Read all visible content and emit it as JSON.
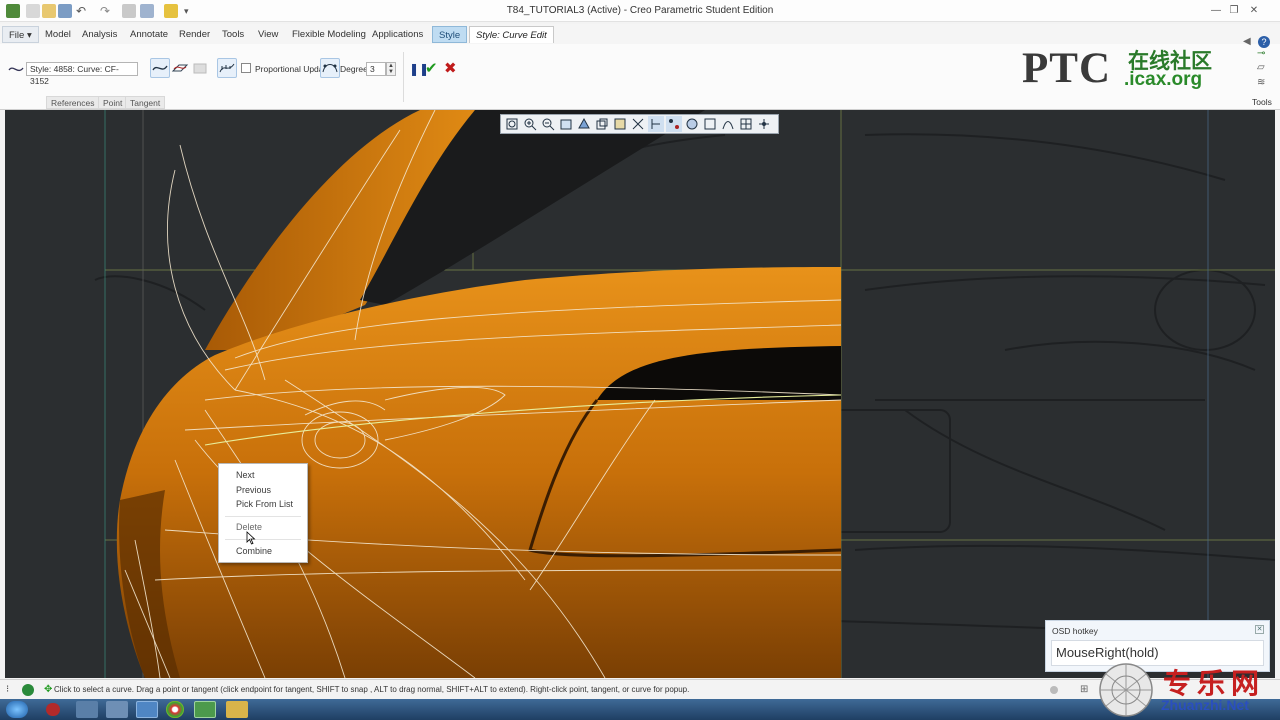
{
  "window": {
    "title": "T84_TUTORIAL3 (Active) - Creo Parametric Student Edition"
  },
  "menu_tabs": [
    {
      "label": "File",
      "suffix": "▾"
    },
    {
      "label": "Model"
    },
    {
      "label": "Analysis"
    },
    {
      "label": "Annotate"
    },
    {
      "label": "Render"
    },
    {
      "label": "Tools"
    },
    {
      "label": "View"
    },
    {
      "label": "Flexible Modeling"
    },
    {
      "label": "Applications"
    },
    {
      "label": "Style"
    },
    {
      "label": "Style: Curve Edit"
    }
  ],
  "ribbon": {
    "curve_selector_value": "Style: 4858: Curve:  CF-3152",
    "proportional_update_label": "Proportional Update",
    "proportional_update_checked": false,
    "degree_label": "Degree",
    "degree_value": "3",
    "subtabs": [
      "References",
      "Point",
      "Tangent"
    ],
    "tools_label": "Tools"
  },
  "logo": {
    "brand": "PTC",
    "chinese": "在线社区",
    "url": ".icax.org"
  },
  "context_menu": {
    "items": [
      "Next",
      "Previous",
      "Pick From List",
      "Delete",
      "Combine"
    ],
    "hovered": "Delete"
  },
  "osd": {
    "title": "OSD hotkey",
    "value": "MouseRight(hold)"
  },
  "status_bar": {
    "message": "Click to select a curve. Drag a point or tangent (click endpoint for tangent, SHIFT to snap , ALT to drag normal, SHIFT+ALT to extend). Right-click point, tangent, or curve for popup."
  },
  "watermark": {
    "chinese": "专乐网",
    "url": "Zhuanzhi.Net"
  },
  "colors": {
    "viewport_bg": "#2b2e30",
    "surface_orange": "#d9820f",
    "accent_blue": "#bfdcf2",
    "accept_green": "#1f9a1f",
    "cancel_red": "#c01b1b"
  }
}
